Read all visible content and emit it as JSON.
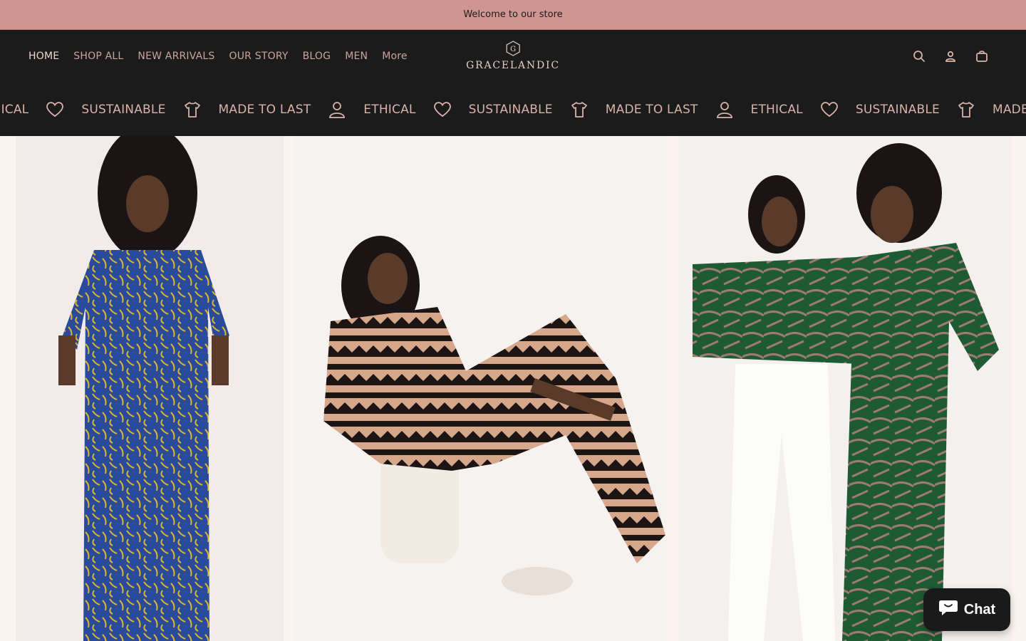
{
  "announcement": {
    "text": "Welcome to our store"
  },
  "header": {
    "nav": [
      {
        "label": "HOME",
        "active": true
      },
      {
        "label": "SHOP ALL"
      },
      {
        "label": "NEW ARRIVALS"
      },
      {
        "label": "OUR STORY"
      },
      {
        "label": "BLOG"
      },
      {
        "label": "MEN"
      },
      {
        "label": "More"
      }
    ],
    "logo_text": "GRACELANDIC",
    "icons": [
      "search-icon",
      "account-icon",
      "cart-icon"
    ]
  },
  "ticker": {
    "items": [
      {
        "label": "THICAL",
        "icon": "heart-icon"
      },
      {
        "label": "SUSTAINABLE",
        "icon": "shirt-icon"
      },
      {
        "label": "MADE TO LAST",
        "icon": "person-icon"
      },
      {
        "label": "ETHICAL",
        "icon": "heart-icon"
      },
      {
        "label": "SUSTAINABLE",
        "icon": "shirt-icon"
      },
      {
        "label": "MADE TO LAST",
        "icon": "person-icon"
      },
      {
        "label": "ETHICAL",
        "icon": "heart-icon"
      },
      {
        "label": "SUSTAINABLE",
        "icon": "shirt-icon"
      },
      {
        "label": "MADE TO LAST",
        "icon": "person-icon"
      }
    ]
  },
  "chat": {
    "label": "Chat"
  },
  "colors": {
    "announcement_bg": "#cf9590",
    "header_bg": "#1b1b1b",
    "nav_text": "#c9a59d",
    "accent": "#d8b3ab"
  }
}
